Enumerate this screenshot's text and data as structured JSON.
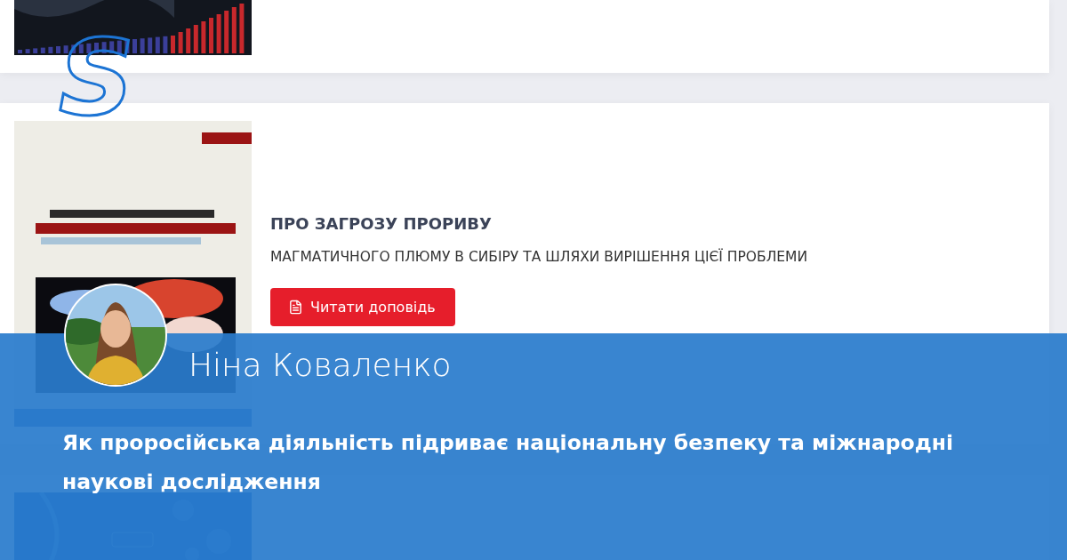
{
  "logo": "S",
  "report": {
    "title": "ПРО ЗАГРОЗУ ПРОРИВУ",
    "subtitle": "МАГМАТИЧНОГО ПЛЮМУ В СИБІРУ ТА ШЛЯХИ ВИРІШЕННЯ ЦІЄЇ ПРОБЛЕМИ",
    "button": "Читати доповідь"
  },
  "author": {
    "name": "Ніна Коваленко"
  },
  "headline": "Як проросійська діяльність підриває національну безпеку та міжнародні наукові дослідження"
}
